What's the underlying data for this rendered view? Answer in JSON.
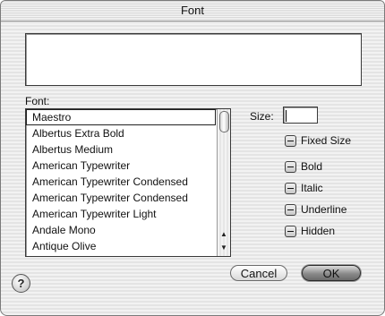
{
  "window": {
    "title": "Font"
  },
  "preview": {
    "text": ""
  },
  "font_list": {
    "label": "Font:",
    "items": [
      "Maestro",
      "Albertus Extra Bold",
      "Albertus Medium",
      "American Typewriter",
      "American Typewriter Condensed",
      "American Typewriter Condensed",
      "American Typewriter Light",
      "Andale Mono",
      "Antique Olive"
    ],
    "selected_index": 0
  },
  "size": {
    "label": "Size:",
    "value": ""
  },
  "options": {
    "fixed_size": "Fixed Size",
    "bold": "Bold",
    "italic": "Italic",
    "underline": "Underline",
    "hidden": "Hidden"
  },
  "buttons": {
    "help": "?",
    "cancel": "Cancel",
    "ok": "OK"
  },
  "icons": {
    "scroll_up": "scroll-up-arrow-icon",
    "scroll_down": "scroll-down-arrow-icon"
  }
}
